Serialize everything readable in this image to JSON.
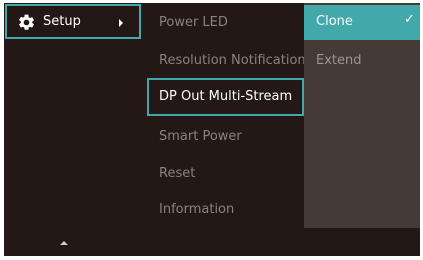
{
  "menu": {
    "setup": {
      "label": "Setup",
      "icon": "gear-icon"
    },
    "scroll_up_icon": "up-arrow-icon"
  },
  "submenu": {
    "items": [
      {
        "label": "Power LED"
      },
      {
        "label": "Resolution Notification"
      },
      {
        "label": "DP Out Multi-Stream"
      },
      {
        "label": "Smart Power"
      },
      {
        "label": "Reset"
      },
      {
        "label": "Information"
      }
    ],
    "selected": "DP Out Multi-Stream"
  },
  "options": {
    "items": [
      {
        "label": "Clone",
        "checked": true,
        "check_mark": "✓"
      },
      {
        "label": "Extend",
        "checked": false
      }
    ]
  },
  "colors": {
    "background": "#241816",
    "accent": "#42a8aa",
    "option_panel": "#463a37"
  }
}
